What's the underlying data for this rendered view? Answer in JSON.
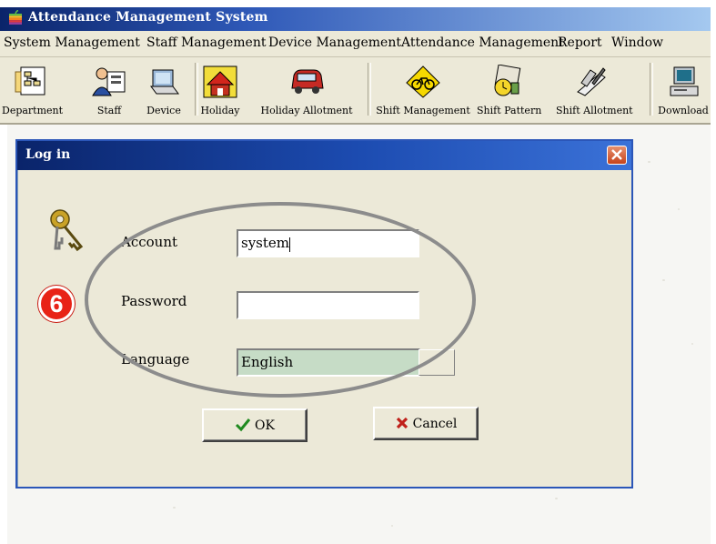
{
  "app": {
    "title": "Attendance Management System"
  },
  "menu": [
    "System Management",
    "Staff Management",
    "Device Management",
    "Attendance Management",
    "Report",
    "Window"
  ],
  "toolbar": [
    {
      "label": "Department",
      "icon": "department-icon"
    },
    {
      "label": "Staff",
      "icon": "staff-icon"
    },
    {
      "label": "Device",
      "icon": "device-icon"
    },
    {
      "label": "Holiday",
      "icon": "holiday-icon"
    },
    {
      "label": "Holiday Allotment",
      "icon": "holiday-allotment-icon"
    },
    {
      "label": "Shift Management",
      "icon": "shift-management-icon"
    },
    {
      "label": "Shift Pattern",
      "icon": "shift-pattern-icon"
    },
    {
      "label": "Shift Allotment",
      "icon": "shift-allotment-icon"
    },
    {
      "label": "Download",
      "icon": "download-icon"
    }
  ],
  "dialog": {
    "title": "Log in",
    "account_label": "Account",
    "account_value": "system",
    "password_label": "Password",
    "password_value": "",
    "language_label": "Language",
    "language_value": "English",
    "ok_label": "OK",
    "cancel_label": "Cancel"
  },
  "annotation": {
    "step": "6"
  },
  "colors": {
    "titlebar": "#0a246a",
    "dialog_border": "#2b56b8",
    "badge": "#e82317",
    "annotation_ellipse": "#8c8c8c"
  }
}
